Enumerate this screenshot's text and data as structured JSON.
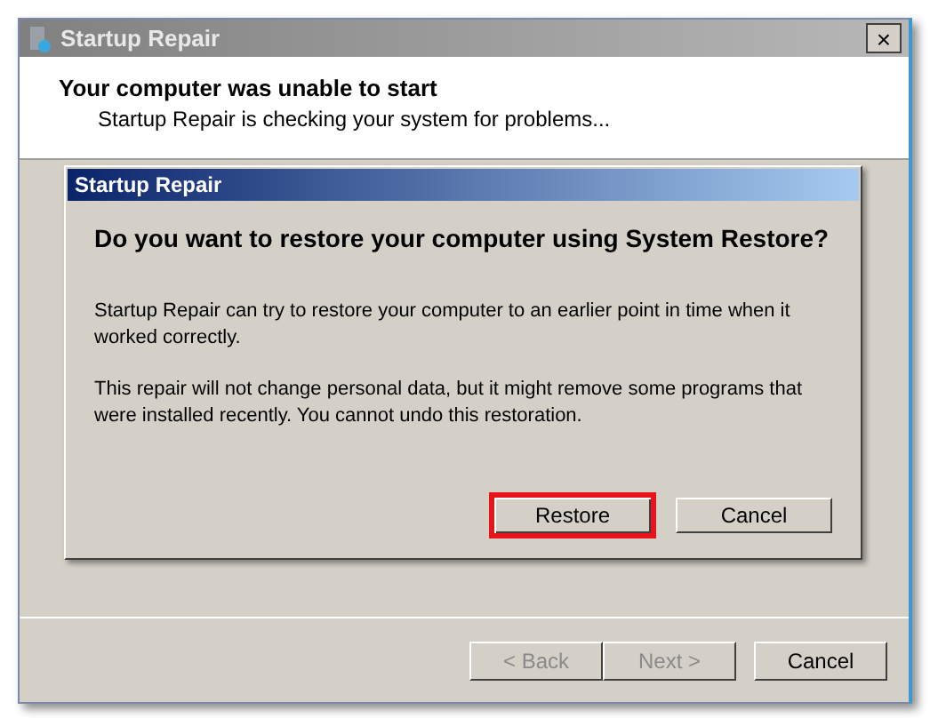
{
  "window": {
    "title": "Startup Repair",
    "close": "×"
  },
  "header": {
    "title": "Your computer was unable to start",
    "subtitle": "Startup Repair is checking your system for problems..."
  },
  "dialog": {
    "title": "Startup Repair",
    "question": "Do you want to restore your computer using System Restore?",
    "paragraphs": [
      "Startup Repair can try to restore your computer to an earlier point in time when it worked correctly.",
      "This repair will not change personal data, but it might remove some programs that were installed recently. You cannot undo this restoration."
    ],
    "buttons": [
      {
        "label": "Restore",
        "highlighted": true
      },
      {
        "label": "Cancel",
        "highlighted": false
      }
    ]
  },
  "footer_buttons": [
    {
      "label": "< Back",
      "disabled": true
    },
    {
      "label": "Next >",
      "disabled": true
    },
    {
      "label": "Cancel",
      "disabled": false
    }
  ]
}
